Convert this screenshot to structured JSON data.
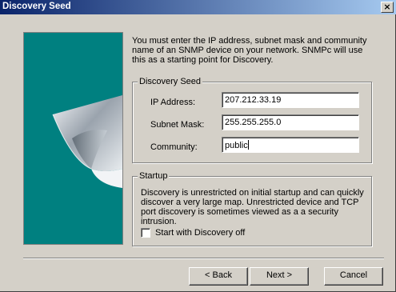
{
  "window": {
    "title": "Discovery Seed",
    "close_glyph": "×"
  },
  "description": "You must enter the IP address, subnet mask and community name of an SNMP device on your network. SNMPc will use this as a starting point for Discovery.",
  "discovery_seed": {
    "group_label": "Discovery Seed",
    "ip_label": "IP Address:",
    "ip_value": "207.212.33.19",
    "subnet_label": "Subnet Mask:",
    "subnet_value": "255.255.255.0",
    "community_label": "Community:",
    "community_value": "public"
  },
  "startup": {
    "group_label": "Startup",
    "text": "Discovery is unrestricted on initial startup and can quickly discover a very large map.  Unrestricted device and TCP port discovery is sometimes viewed as a a security intrusion.",
    "checkbox_label": "Start with Discovery off",
    "checkbox_checked": false
  },
  "buttons": {
    "back": "< Back",
    "next": "Next >",
    "cancel": "Cancel"
  },
  "colors": {
    "title_gradient_start": "#0a246a",
    "title_gradient_end": "#a6caf0",
    "panel_background": "#008080",
    "dialog_background": "#d4d0c8"
  },
  "icons": {
    "wizard_image": "page-curl-graphic",
    "close": "close-icon",
    "caret": "text-caret"
  }
}
